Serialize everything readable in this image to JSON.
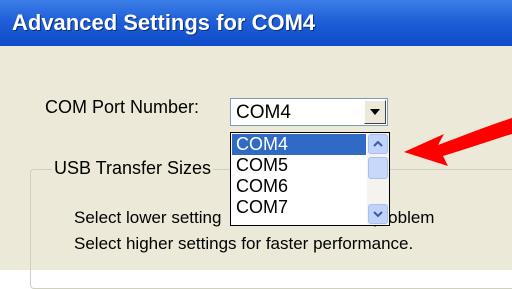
{
  "window": {
    "title": "Advanced Settings for COM4"
  },
  "port": {
    "label": "COM Port Number:",
    "selected": "COM4",
    "options": [
      "COM4",
      "COM5",
      "COM6",
      "COM7"
    ]
  },
  "usb_group": {
    "title": "USB Transfer Sizes",
    "line1_visible_left": "Select lower setting",
    "line1_visible_right": "nance problem",
    "line2": "Select higher settings for faster performance."
  },
  "colors": {
    "titlebar": "#1f5fd8",
    "selection": "#316ac5",
    "annotation_arrow": "#ff0000"
  },
  "icons": {
    "combo_dropdown": "chevron-down-icon",
    "scroll_up": "scroll-up-icon",
    "scroll_down": "scroll-down-icon",
    "annotation": "red-arrow-icon"
  }
}
